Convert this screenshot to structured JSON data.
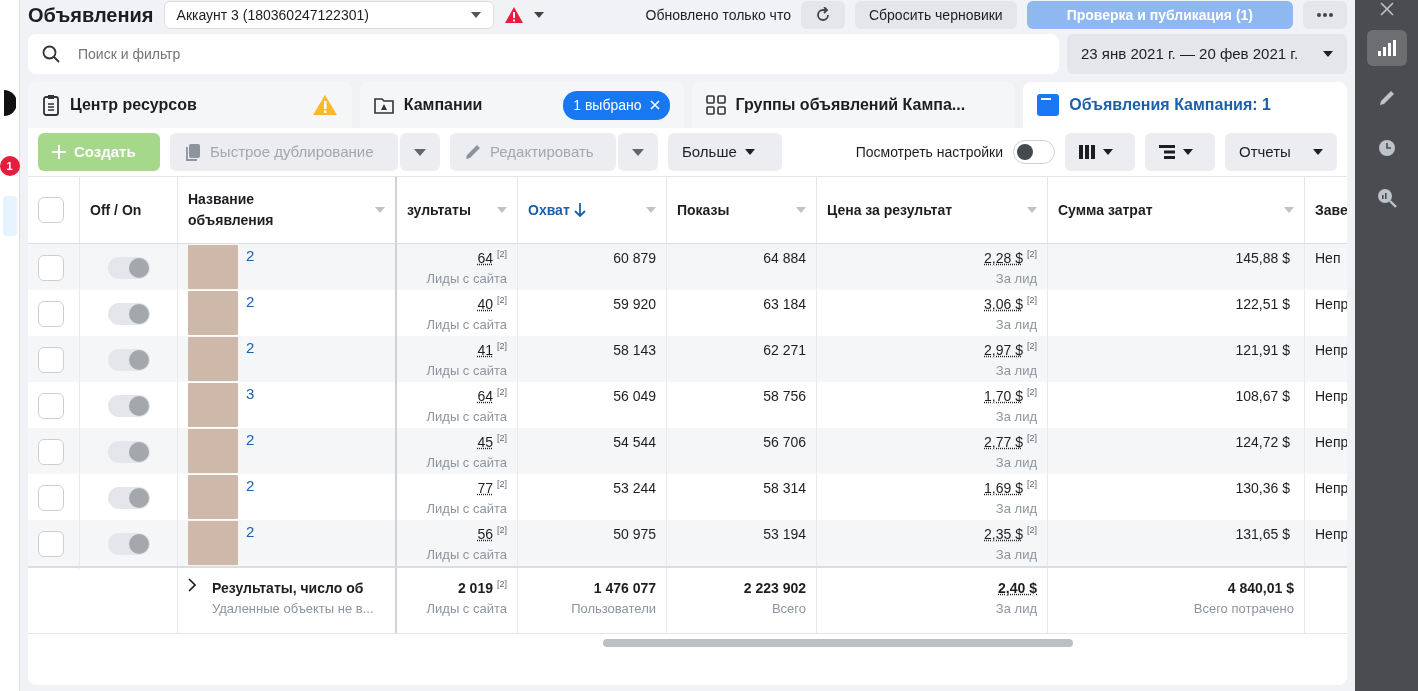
{
  "header": {
    "title": "Объявления",
    "account": "Аккаунт 3 (180360247122301)",
    "status": "Обновлено только что",
    "reset_button": "Сбросить черновики",
    "publish_button": {
      "label": "Проверка и публикация (1)",
      "disabled": true
    }
  },
  "left_rail": {
    "badge": "1"
  },
  "search": {
    "placeholder": "Поиск и фильтр"
  },
  "date_range": "23 янв 2021 г. — 20 фев 2021 г.",
  "tabs": [
    {
      "kind": "resources",
      "label": "Центр ресурсов",
      "selected": false,
      "warning": true
    },
    {
      "kind": "campaigns",
      "label": "Кампании",
      "selected": false,
      "chip": "1 выбрано"
    },
    {
      "kind": "adsets",
      "label": "Группы объявлений Кампа...",
      "selected": false
    },
    {
      "kind": "ads",
      "label": "Объявления Кампания: 1",
      "selected": true
    }
  ],
  "toolbar": {
    "create": {
      "label": "Создать",
      "disabled": true
    },
    "duplicate": {
      "label": "Быстрое дублирование",
      "disabled": true
    },
    "edit": {
      "label": "Редактировать",
      "disabled": true
    },
    "more": "Больше",
    "view_settings": {
      "label": "Посмотреть настройки",
      "on": false
    },
    "reports": "Отчеты"
  },
  "table": {
    "select_all_checked": false,
    "columns": [
      {
        "label": "Off / On",
        "sorted": false
      },
      {
        "label": "Название объявления",
        "sorted": false
      },
      {
        "label": "зультаты",
        "sorted": false
      },
      {
        "label": "Охват",
        "sorted": true
      },
      {
        "label": "Показы",
        "sorted": false
      },
      {
        "label": "Цена за результат",
        "sorted": false
      },
      {
        "label": "Сумма затрат",
        "sorted": false
      },
      {
        "label": "Заве",
        "sorted": false
      }
    ],
    "rows": [
      {
        "checked": false,
        "on": true,
        "name": "2",
        "results": "64",
        "results_note": "[2]",
        "results_label": "Лиды с сайта",
        "reach": "60 879",
        "impressions": "64 884",
        "cost": "2,28 $",
        "cost_note": "[2]",
        "cost_label": "За лид",
        "spent": "145,88 $",
        "delivery": "Неп"
      },
      {
        "checked": false,
        "on": true,
        "name": "2",
        "results": "40",
        "results_note": "[2]",
        "results_label": "Лиды с сайта",
        "reach": "59 920",
        "impressions": "63 184",
        "cost": "3,06 $",
        "cost_note": "[2]",
        "cost_label": "За лид",
        "spent": "122,51 $",
        "delivery": "Непр"
      },
      {
        "checked": false,
        "on": true,
        "name": "2",
        "results": "41",
        "results_note": "[2]",
        "results_label": "Лиды с сайта",
        "reach": "58 143",
        "impressions": "62 271",
        "cost": "2,97 $",
        "cost_note": "[2]",
        "cost_label": "За лид",
        "spent": "121,91 $",
        "delivery": "Непр"
      },
      {
        "checked": false,
        "on": true,
        "name": "3",
        "results": "64",
        "results_note": "[2]",
        "results_label": "Лиды с сайта",
        "reach": "56 049",
        "impressions": "58 756",
        "cost": "1,70 $",
        "cost_note": "[2]",
        "cost_label": "За лид",
        "spent": "108,67 $",
        "delivery": "Непр"
      },
      {
        "checked": false,
        "on": true,
        "name": "2",
        "results": "45",
        "results_note": "[2]",
        "results_label": "Лиды с сайта",
        "reach": "54 544",
        "impressions": "56 706",
        "cost": "2,77 $",
        "cost_note": "[2]",
        "cost_label": "За лид",
        "spent": "124,72 $",
        "delivery": "Непр"
      },
      {
        "checked": false,
        "on": true,
        "name": "2",
        "results": "77",
        "results_note": "[2]",
        "results_label": "Лиды с сайта",
        "reach": "53 244",
        "impressions": "58 314",
        "cost": "1,69 $",
        "cost_note": "[2]",
        "cost_label": "За лид",
        "spent": "130,36 $",
        "delivery": "Непр"
      },
      {
        "checked": false,
        "on": true,
        "name": "2",
        "results": "56",
        "results_note": "[2]",
        "results_label": "Лиды с сайта",
        "reach": "50 975",
        "impressions": "53 194",
        "cost": "2,35 $",
        "cost_note": "[2]",
        "cost_label": "За лид",
        "spent": "131,65 $",
        "delivery": "Непр"
      }
    ],
    "totals": {
      "label": "Результаты, число об",
      "sublabel": "Удаленные объекты не в...",
      "results": "2 019",
      "results_note": "[2]",
      "results_label": "Лиды с сайта",
      "reach": "1 476 077",
      "reach_label": "Пользователи",
      "impressions": "2 223 902",
      "impressions_label": "Всего",
      "cost": "2,40 $",
      "cost_label": "За лид",
      "spent": "4 840,01 $",
      "spent_label": "Всего потрачено"
    }
  }
}
